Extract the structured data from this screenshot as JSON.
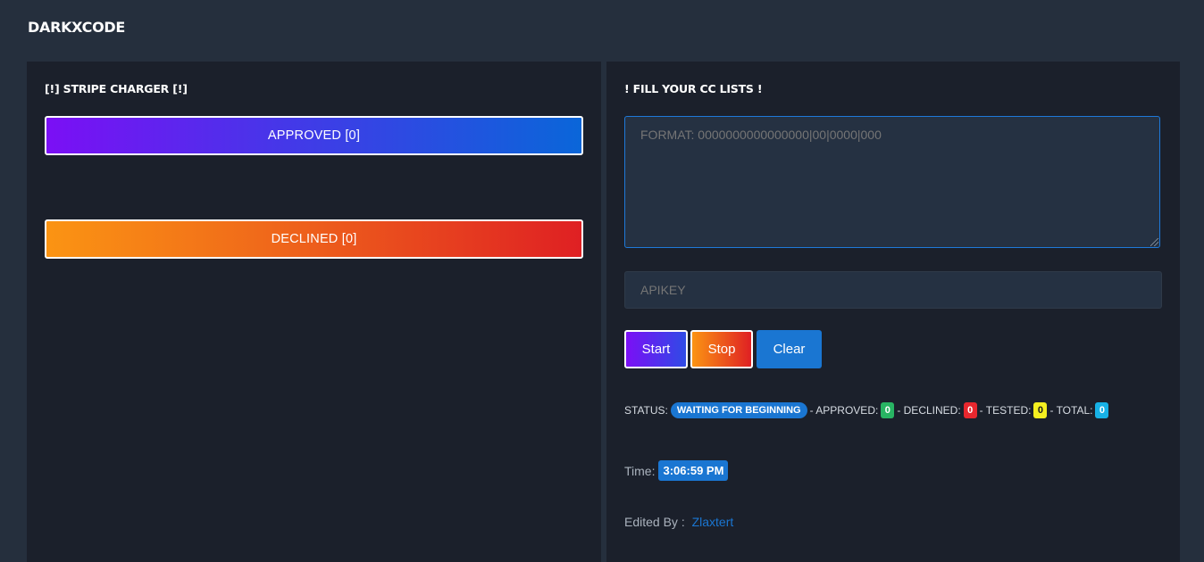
{
  "brand": "DARKXCODE",
  "left_panel": {
    "title": "[!] STRIPE CHARGER [!]",
    "approved_label": "APPROVED [0]",
    "declined_label": "DECLINED [0]"
  },
  "right_panel": {
    "title": "! FILL YOUR CC LISTS !",
    "cc_placeholder": "FORMAT: 0000000000000000|00|0000|000",
    "apikey_placeholder": "APIKEY",
    "buttons": {
      "start": "Start",
      "stop": "Stop",
      "clear": "Clear"
    },
    "status": {
      "label": "STATUS:",
      "value": "WAITING FOR BEGINNING",
      "approved_label": "- APPROVED:",
      "approved": "0",
      "declined_label": "- DECLINED:",
      "declined": "0",
      "tested_label": "- TESTED:",
      "tested": "0",
      "total_label": "- TOTAL:",
      "total": "0"
    },
    "time_label": "Time:",
    "time_value": "3:06:59 PM",
    "edited_label": "Edited By :",
    "edited_author": "Zlaxtert"
  },
  "colors": {
    "page_bg": "#252f3d",
    "panel_bg": "#1b202b",
    "accent_blue": "#1a76d2",
    "approved_green": "#28b463",
    "declined_red": "#e8272e",
    "tested_yellow": "#f4ef20",
    "total_cyan": "#17b1e6"
  }
}
